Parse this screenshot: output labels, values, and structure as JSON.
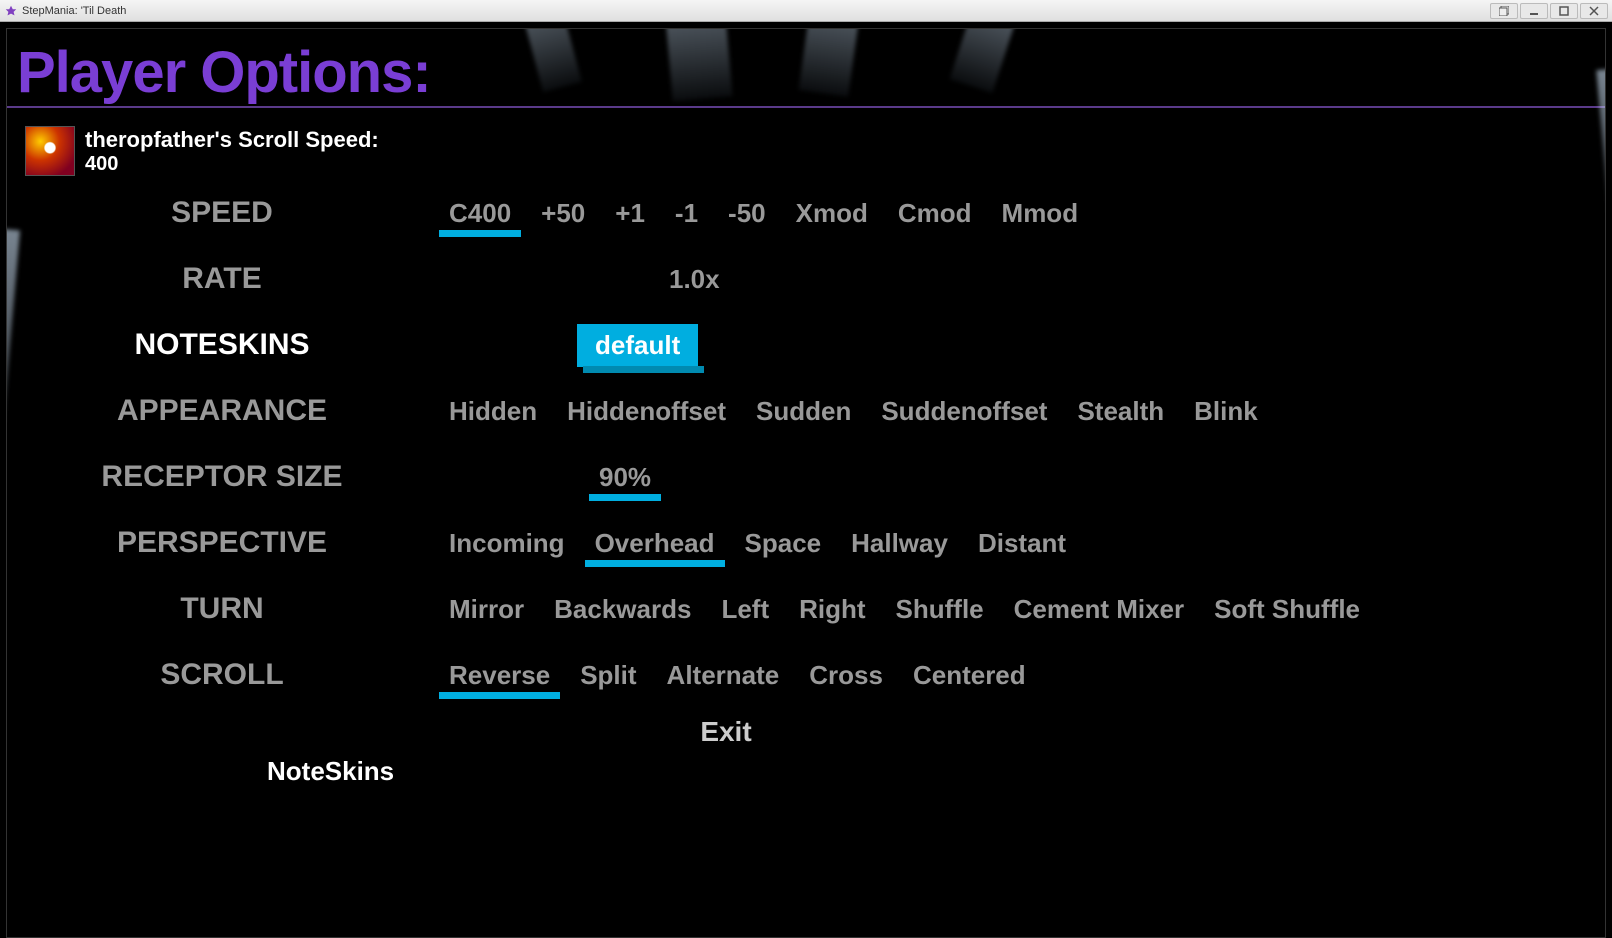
{
  "window": {
    "title": "StepMania: 'Til Death"
  },
  "header": {
    "title": "Player Options:"
  },
  "player": {
    "scroll_speed_label": "theropfather's Scroll Speed:",
    "scroll_speed_value": "400"
  },
  "rows": {
    "speed": {
      "label": "SPEED",
      "options": [
        "C400",
        "+50",
        "+1",
        "-1",
        "-50",
        "Xmod",
        "Cmod",
        "Mmod"
      ],
      "selected_index": 0,
      "current_row": false
    },
    "rate": {
      "label": "RATE",
      "options": [
        "1.0x"
      ],
      "selected_index": -1,
      "current_row": false
    },
    "noteskins": {
      "label": "NOTESKINS",
      "options": [
        "default"
      ],
      "selected_index": 0,
      "current_row": true,
      "highlighted": true
    },
    "appearance": {
      "label": "APPEARANCE",
      "options": [
        "Hidden",
        "Hiddenoffset",
        "Sudden",
        "Suddenoffset",
        "Stealth",
        "Blink"
      ],
      "selected_index": -1,
      "current_row": false
    },
    "receptor_size": {
      "label": "RECEPTOR SIZE",
      "options": [
        "90%"
      ],
      "selected_index": 0,
      "current_row": false
    },
    "perspective": {
      "label": "PERSPECTIVE",
      "options": [
        "Incoming",
        "Overhead",
        "Space",
        "Hallway",
        "Distant"
      ],
      "selected_index": 1,
      "current_row": false
    },
    "turn": {
      "label": "TURN",
      "options": [
        "Mirror",
        "Backwards",
        "Left",
        "Right",
        "Shuffle",
        "Cement Mixer",
        "Soft Shuffle"
      ],
      "selected_index": -1,
      "current_row": false
    },
    "scroll": {
      "label": "SCROLL",
      "options": [
        "Reverse",
        "Split",
        "Alternate",
        "Cross",
        "Centered"
      ],
      "selected_index": 0,
      "current_row": false
    }
  },
  "exit_label": "Exit",
  "tooltip": "NoteSkins"
}
